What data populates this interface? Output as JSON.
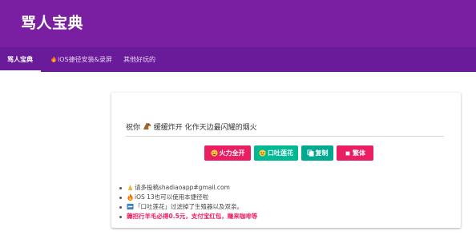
{
  "app": {
    "title": "骂人宝典"
  },
  "tabs": [
    {
      "label": "骂人宝典",
      "active": true
    },
    {
      "label": "iOS捷径安装&录屏",
      "icon": "fire-icon",
      "active": false
    },
    {
      "label": "其他好玩的",
      "active": false
    }
  ],
  "output": {
    "text_before": "祝你",
    "emoji": "horse-icon",
    "text_after": "缓缓炸开 化作天边最闪耀的烟火"
  },
  "buttons": [
    {
      "label": "火力全开",
      "icon": "hot-face-icon",
      "color": "#e91e63"
    },
    {
      "label": "口吐莲花",
      "icon": "smile-icon",
      "color": "#00b894"
    },
    {
      "label": "复制",
      "icon": "copy-icon",
      "color": "#00a98f"
    },
    {
      "label": "繁体",
      "icon": "square-icon",
      "color": "#e91e63"
    }
  ],
  "notes": [
    {
      "icon": "pray-icon",
      "text": "请多投稿shadiaoapp#gmail.com"
    },
    {
      "icon": "fire-icon",
      "text": "iOS 13也可以使用本捷径啦"
    },
    {
      "icon": "new-icon",
      "text": "「口吐莲花」过滤掉了生殖器以及双亲。"
    },
    {
      "icon": "",
      "text": "薅招行羊毛必得0.5元，支付宝红包，赚来咖啡等"
    }
  ],
  "colors": {
    "header": "#7b1fa2",
    "tabbar": "#6a1b9a",
    "pink": "#e91e63",
    "teal": "#00b894"
  }
}
